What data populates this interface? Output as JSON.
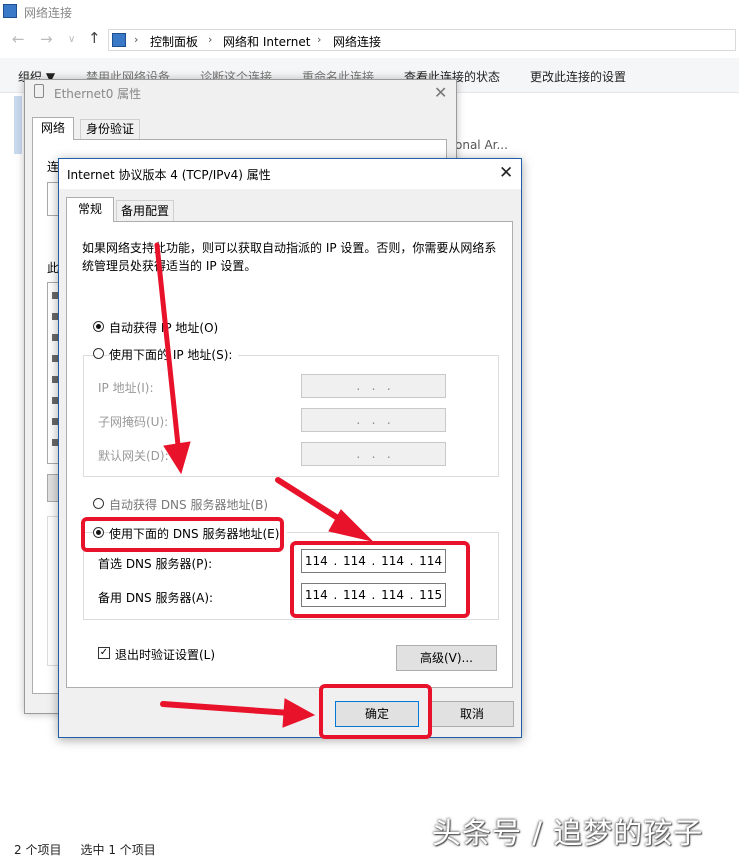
{
  "explorer": {
    "window_title": "网络连接",
    "breadcrumb": [
      "控制面板",
      "网络和 Internet",
      "网络连接"
    ],
    "commands": [
      "组织 ▼",
      "禁用此网络设备",
      "诊断这个连接",
      "重命名此连接",
      "查看此连接的状态",
      "更改此连接的设置"
    ],
    "partial_item_text": "onal Ar...",
    "status": {
      "count": "2 个项目",
      "selected": "选中 1 个项目"
    }
  },
  "ethernet_dialog": {
    "title": "Ethernet0 属性",
    "tabs": [
      "网络",
      "身份验证"
    ],
    "partial_labels": [
      "连",
      "此"
    ]
  },
  "ipv4_dialog": {
    "title": "Internet 协议版本 4 (TCP/IPv4) 属性",
    "tabs": [
      "常规",
      "备用配置"
    ],
    "description": "如果网络支持此功能，则可以获取自动指派的 IP 设置。否则，你需要从网络系统管理员处获得适当的 IP 设置。",
    "ip_auto_label": "自动获得 IP 地址(O)",
    "ip_manual_label": "使用下面的 IP 地址(S):",
    "ip_fields": [
      {
        "label": "IP 地址(I):",
        "value": ".   .   ."
      },
      {
        "label": "子网掩码(U):",
        "value": ".   .   ."
      },
      {
        "label": "默认网关(D):",
        "value": ".   .   ."
      }
    ],
    "dns_auto_label": "自动获得 DNS 服务器地址(B)",
    "dns_manual_label": "使用下面的 DNS 服务器地址(E):",
    "dns_fields": [
      {
        "label": "首选 DNS 服务器(P):",
        "octets": [
          "114",
          "114",
          "114",
          "114"
        ]
      },
      {
        "label": "备用 DNS 服务器(A):",
        "octets": [
          "114",
          "114",
          "114",
          "115"
        ]
      }
    ],
    "validate_label": "退出时验证设置(L)",
    "advanced_button": "高级(V)...",
    "ok_button": "确定",
    "cancel_button": "取消",
    "selected_ip_mode": "auto",
    "selected_dns_mode": "manual",
    "validate_checked": true
  },
  "watermark": "头条号 / 追梦的孩子",
  "colors": {
    "annotation_red": "#e8132a",
    "focus_blue": "#0078d7"
  }
}
